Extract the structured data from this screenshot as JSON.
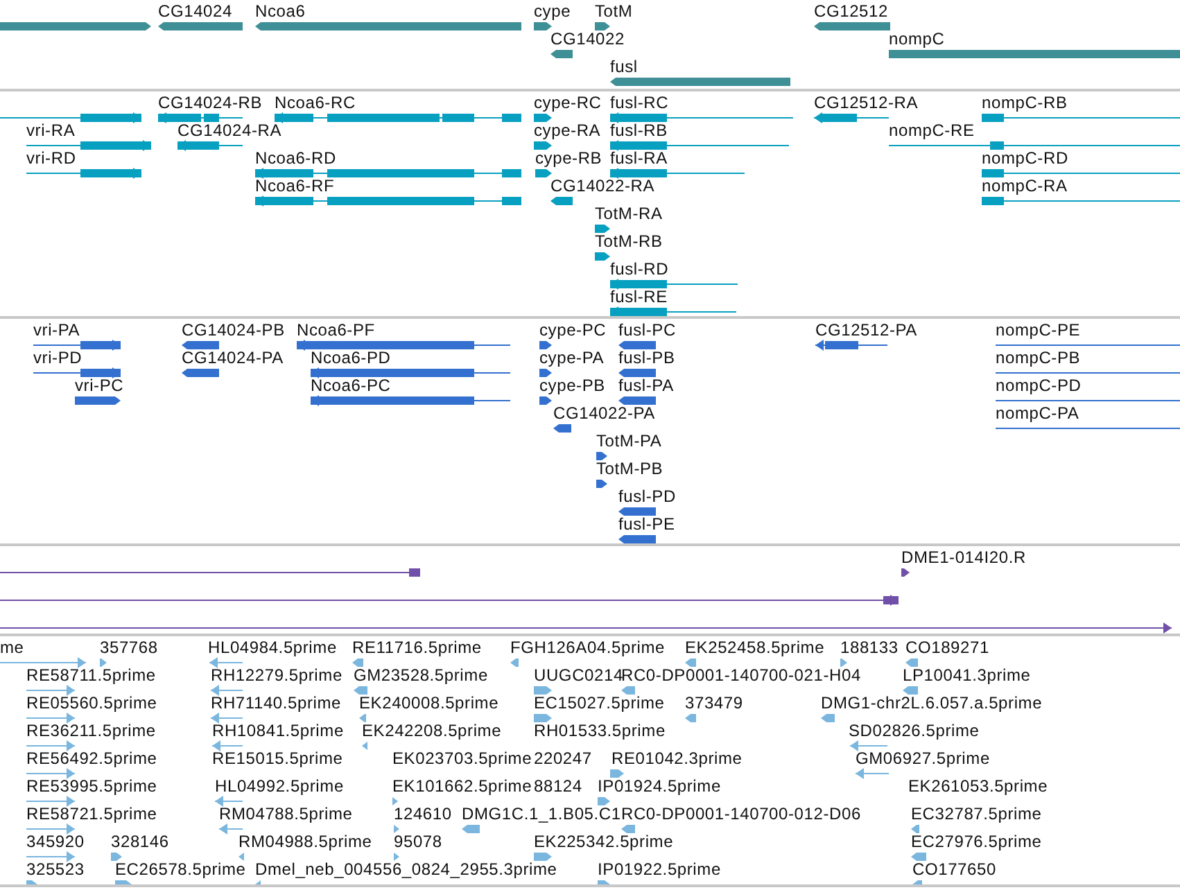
{
  "tracks": [
    {
      "color": "#3f8f96",
      "features": [
        {
          "reverse": false
        },
        {
          "label": "CG14024",
          "reverse": true
        },
        {
          "label": "Ncoa6",
          "reverse": true
        },
        {
          "label": "cype",
          "reverse": false
        },
        {
          "label": "TotM",
          "reverse": false
        },
        {
          "label": "CG12512",
          "reverse": true
        },
        {
          "label": "CG14022",
          "reverse": true
        },
        {
          "label": "nompC",
          "reverse": false
        },
        {
          "label": "fusl",
          "reverse": true
        }
      ]
    },
    {
      "color": "#08a0c0",
      "features": [
        {
          "reverse": false
        },
        {
          "label": "CG14024-RB",
          "reverse": true
        },
        {
          "label": "Ncoa6-RC",
          "reverse": true
        },
        {
          "label": "cype-RC",
          "reverse": false
        },
        {
          "label": "fusl-RC",
          "reverse": true
        },
        {
          "label": "CG12512-RA",
          "reverse": true
        },
        {
          "label": "nompC-RB",
          "reverse": false
        },
        {
          "label": "vri-RA",
          "reverse": false
        },
        {
          "label": "CG14024-RA",
          "reverse": true
        },
        {
          "label": "cype-RA",
          "reverse": false
        },
        {
          "label": "fusl-RB",
          "reverse": true
        },
        {
          "label": "nompC-RE",
          "reverse": false
        },
        {
          "label": "vri-RD",
          "reverse": false
        },
        {
          "label": "Ncoa6-RD",
          "reverse": true
        },
        {
          "label": "cype-RB",
          "reverse": false
        },
        {
          "label": "fusl-RA",
          "reverse": true
        },
        {
          "label": "nompC-RD",
          "reverse": false
        },
        {
          "label": "Ncoa6-RF",
          "reverse": true
        },
        {
          "label": "CG14022-RA",
          "reverse": true
        },
        {
          "label": "nompC-RA",
          "reverse": false
        },
        {
          "label": "TotM-RA",
          "reverse": false
        },
        {
          "label": "TotM-RB",
          "reverse": false
        },
        {
          "label": "fusl-RD",
          "reverse": true
        },
        {
          "label": "fusl-RE",
          "reverse": true
        }
      ]
    },
    {
      "color": "#3370d0",
      "features": [
        {
          "label": "vri-PA",
          "reverse": false
        },
        {
          "label": "CG14024-PB",
          "reverse": true
        },
        {
          "label": "Ncoa6-PF",
          "reverse": true
        },
        {
          "label": "cype-PC",
          "reverse": false
        },
        {
          "label": "fusl-PC",
          "reverse": true
        },
        {
          "label": "CG12512-PA",
          "reverse": true
        },
        {
          "label": "nompC-PE",
          "reverse": false
        },
        {
          "label": "vri-PD",
          "reverse": false
        },
        {
          "label": "CG14024-PA",
          "reverse": true
        },
        {
          "label": "Ncoa6-PD",
          "reverse": true
        },
        {
          "label": "cype-PA",
          "reverse": false
        },
        {
          "label": "fusl-PB",
          "reverse": true
        },
        {
          "label": "nompC-PB",
          "reverse": false
        },
        {
          "label": "vri-PC",
          "reverse": false
        },
        {
          "label": "Ncoa6-PC",
          "reverse": true
        },
        {
          "label": "cype-PB",
          "reverse": false
        },
        {
          "label": "fusl-PA",
          "reverse": true
        },
        {
          "label": "nompC-PD",
          "reverse": false
        },
        {
          "label": "CG14022-PA",
          "reverse": true
        },
        {
          "label": "nompC-PA",
          "reverse": false
        },
        {
          "label": "TotM-PA",
          "reverse": false
        },
        {
          "label": "TotM-PB",
          "reverse": false
        },
        {
          "label": "fusl-PD",
          "reverse": true
        },
        {
          "label": "fusl-PE",
          "reverse": true
        }
      ]
    },
    {
      "color": "#7050a8",
      "features": [
        {
          "reverse": true
        },
        {
          "label": "DME1-014I20.R",
          "reverse": false
        },
        {
          "reverse": false
        },
        {
          "reverse": false
        }
      ]
    },
    {
      "color": "#7ab6de",
      "features": [
        {
          "label": "me",
          "reverse": false
        },
        {
          "label": "357768",
          "reverse": false
        },
        {
          "label": "HL04984.5prime",
          "reverse": true
        },
        {
          "label": "RE11716.5prime",
          "reverse": true
        },
        {
          "label": "FGH126A04.5prime",
          "reverse": true
        },
        {
          "label": "EK252458.5prime",
          "reverse": true
        },
        {
          "label": "188133",
          "reverse": false
        },
        {
          "label": "CO189271",
          "reverse": true
        },
        {
          "label": "RE58711.5prime",
          "reverse": false
        },
        {
          "label": "RH12279.5prime",
          "reverse": true
        },
        {
          "label": "GM23528.5prime",
          "reverse": true
        },
        {
          "label": "UUGC0214",
          "reverse": false
        },
        {
          "label": "RC0-DP0001-140700-021-H04",
          "reverse": true
        },
        {
          "label": "LP10041.3prime",
          "reverse": true
        },
        {
          "label": "RE05560.5prime",
          "reverse": false
        },
        {
          "label": "RH71140.5prime",
          "reverse": true
        },
        {
          "label": "EK240008.5prime",
          "reverse": true
        },
        {
          "label": "EC15027.5prime",
          "reverse": false
        },
        {
          "label": "373479",
          "reverse": true
        },
        {
          "label": "DMG1-chr2L.6.057.a.5prime",
          "reverse": true
        },
        {
          "label": "RE36211.5prime",
          "reverse": false
        },
        {
          "label": "RH10841.5prime",
          "reverse": true
        },
        {
          "label": "EK242208.5prime",
          "reverse": true
        },
        {
          "label": "RH01533.5prime"
        },
        {
          "label": "SD02826.5prime",
          "reverse": true
        },
        {
          "label": "RE56492.5prime",
          "reverse": false
        },
        {
          "label": "RE15015.5prime"
        },
        {
          "label": "EK023703.5prime"
        },
        {
          "label": "220247"
        },
        {
          "label": "RE01042.3prime",
          "reverse": false
        },
        {
          "label": "GM06927.5prime",
          "reverse": true
        },
        {
          "label": "RE53995.5prime",
          "reverse": false
        },
        {
          "label": "HL04992.5prime",
          "reverse": true
        },
        {
          "label": "EK101662.5prime",
          "reverse": false
        },
        {
          "label": "88124"
        },
        {
          "label": "IP01924.5prime",
          "reverse": false
        },
        {
          "label": "EK261053.5prime"
        },
        {
          "label": "RE58721.5prime",
          "reverse": false
        },
        {
          "label": "RM04788.5prime",
          "reverse": true
        },
        {
          "label": "124610",
          "reverse": false
        },
        {
          "label": "DMG1C.1_1.B05.C1",
          "reverse": true
        },
        {
          "label": "RC0-DP0001-140700-012-D06",
          "reverse": true
        },
        {
          "label": "EC32787.5prime",
          "reverse": true
        },
        {
          "label": "345920",
          "reverse": false
        },
        {
          "label": "328146",
          "reverse": false
        },
        {
          "label": "RM04988.5prime",
          "reverse": true
        },
        {
          "label": "95078",
          "reverse": false
        },
        {
          "label": "EK225342.5prime",
          "reverse": false
        },
        {
          "label": "EC27976.5prime",
          "reverse": true
        },
        {
          "label": "325523",
          "reverse": false
        },
        {
          "label": "EC26578.5prime",
          "reverse": false
        },
        {
          "label": "Dmel_neb_004556_0824_2955.3prime",
          "reverse": true
        },
        {
          "label": "IP01922.5prime",
          "reverse": false
        },
        {
          "label": "CO177650",
          "reverse": true
        }
      ]
    }
  ]
}
